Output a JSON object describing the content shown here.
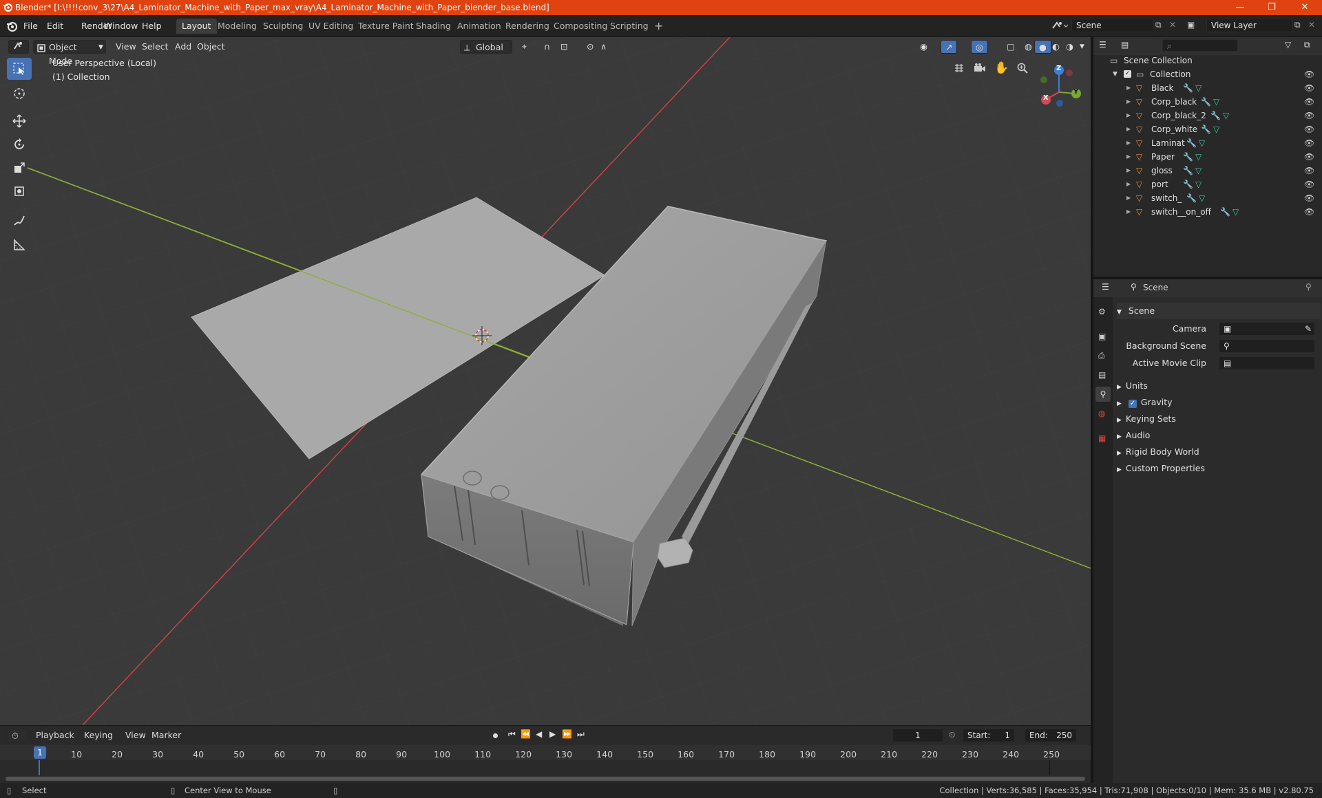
{
  "window": {
    "title": "Blender* [I:\\!!!!conv_3\\27\\A4_Laminator_Machine_with_Paper_max_vray\\A4_Laminator_Machine_with_Paper_blender_base.blend]",
    "minimize": "—",
    "maximize": "❐",
    "close": "✕"
  },
  "menu": [
    "File",
    "Edit",
    "Render",
    "Window",
    "Help"
  ],
  "workspaces": [
    "Layout",
    "Modeling",
    "Sculpting",
    "UV Editing",
    "Texture Paint",
    "Shading",
    "Animation",
    "Rendering",
    "Compositing",
    "Scripting"
  ],
  "add_workspace": "+",
  "scene_field": "Scene",
  "view_layer_field": "View Layer",
  "viewport": {
    "mode": "Object Mode",
    "menus": [
      "View",
      "Select",
      "Add",
      "Object"
    ],
    "orientation": "Global",
    "overlay_line1": "User Perspective (Local)",
    "overlay_line2": "(1) Collection",
    "gizmo": {
      "x": "X",
      "y": "Y",
      "z": "Z"
    }
  },
  "outliner": {
    "root": "Scene Collection",
    "collection": "Collection",
    "objects": [
      "Black",
      "Corp_black",
      "Corp_black_2",
      "Corp_white",
      "Laminat",
      "Paper",
      "gloss",
      "port",
      "switch_",
      "switch__on_off"
    ]
  },
  "properties": {
    "header": "Scene",
    "panel": "Scene",
    "camera_label": "Camera",
    "background_label": "Background Scene",
    "clip_label": "Active Movie Clip",
    "sections": [
      "Units",
      "Gravity",
      "Keying Sets",
      "Audio",
      "Rigid Body World",
      "Custom Properties"
    ]
  },
  "timeline": {
    "menus": [
      "Playback",
      "Keying",
      "View",
      "Marker"
    ],
    "current_frame": "1",
    "start_label": "Start:",
    "start": "1",
    "end_label": "End:",
    "end": "250",
    "ticks": [
      "1",
      "10",
      "20",
      "30",
      "40",
      "50",
      "60",
      "70",
      "80",
      "90",
      "100",
      "110",
      "120",
      "130",
      "140",
      "150",
      "160",
      "170",
      "180",
      "190",
      "200",
      "210",
      "220",
      "230",
      "240",
      "250"
    ]
  },
  "status": {
    "select": "Select",
    "center": "Center View to Mouse",
    "stats": "Collection | Verts:36,585 | Faces:35,954 | Tris:71,908 | Objects:0/10 | Mem: 35.6 MB | v2.80.75"
  },
  "colors": {
    "title_bar": "#e0430f",
    "accent": "#4772b3",
    "x_axis": "#c8414b",
    "y_axis": "#8bb034",
    "mesh_icon": "#e69138"
  }
}
